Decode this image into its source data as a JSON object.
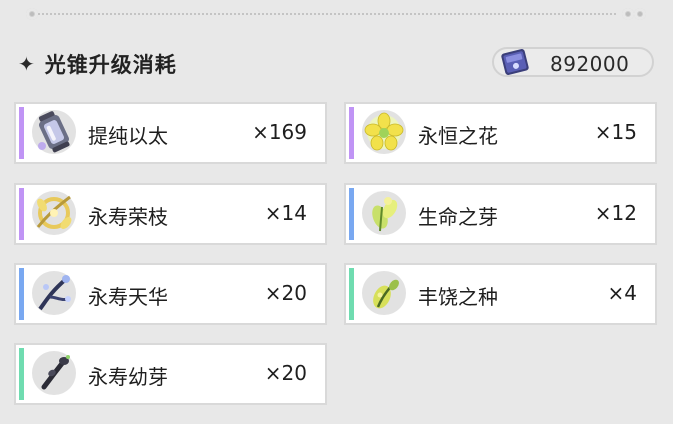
{
  "header": {
    "title": "光锥升级消耗",
    "sparkle_icon": "sparkle-icon"
  },
  "currency": {
    "icon": "credit-card-icon",
    "amount": "892000"
  },
  "colors": {
    "purple_rarity": "#c094f5",
    "blue_rarity": "#79a8f1",
    "green_rarity": "#6fdcb0",
    "background": "#e8e8e8"
  },
  "materials": [
    {
      "name": "提纯以太",
      "quantity": "×169",
      "rarity": "purple",
      "icon": "ether-canister-icon"
    },
    {
      "name": "永恒之花",
      "quantity": "×15",
      "rarity": "purple",
      "icon": "yellow-flower-icon"
    },
    {
      "name": "永寿荣枝",
      "quantity": "×14",
      "rarity": "purple",
      "icon": "golden-branch-icon"
    },
    {
      "name": "生命之芽",
      "quantity": "×12",
      "rarity": "blue",
      "icon": "green-bud-icon"
    },
    {
      "name": "永寿天华",
      "quantity": "×20",
      "rarity": "blue",
      "icon": "blue-branch-icon"
    },
    {
      "name": "丰饶之种",
      "quantity": "×4",
      "rarity": "green",
      "icon": "seed-icon"
    },
    {
      "name": "永寿幼芽",
      "quantity": "×20",
      "rarity": "green",
      "icon": "dark-sprout-icon"
    }
  ]
}
